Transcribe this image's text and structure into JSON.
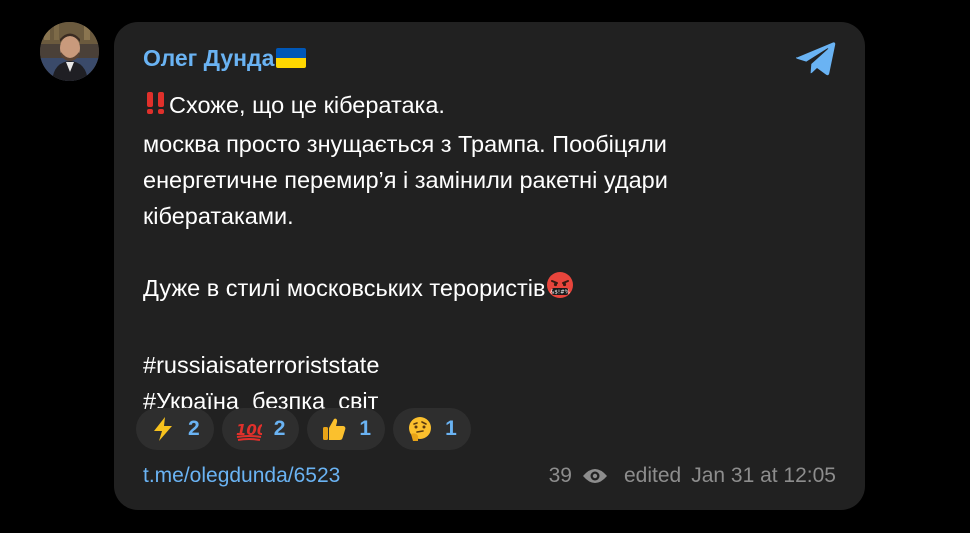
{
  "author": {
    "name": "Олег Дунда"
  },
  "message": {
    "line1": "Схоже, що це кібератака.",
    "line2": "москва просто знущається з Трампа. Пообіцяли",
    "line3": "енергетичне перемир’я і замінили ракетні удари",
    "line4": "кібератаками.",
    "line5": "Дуже в стилі московських терористів",
    "hashtag1": "#russiaisaterroriststate",
    "hashtag2": "#Україна_безпка_світ"
  },
  "reactions": [
    {
      "emoji": "lightning-emoji",
      "count": "2"
    },
    {
      "emoji": "hundred-points-emoji",
      "count": "2"
    },
    {
      "emoji": "thumbs-up-emoji",
      "count": "1"
    },
    {
      "emoji": "thinking-face-emoji",
      "count": "1"
    }
  ],
  "footer": {
    "link": "t.me/olegdunda/6523",
    "views": "39",
    "edited_label": "edited",
    "timestamp": "Jan 31 at 12:05"
  },
  "colors": {
    "background": "#000000",
    "bubble": "#212121",
    "accent": "#6ab3f3",
    "muted": "#8d8d8d",
    "text": "#ffffff",
    "reaction_bg": "#2e2e2e"
  }
}
